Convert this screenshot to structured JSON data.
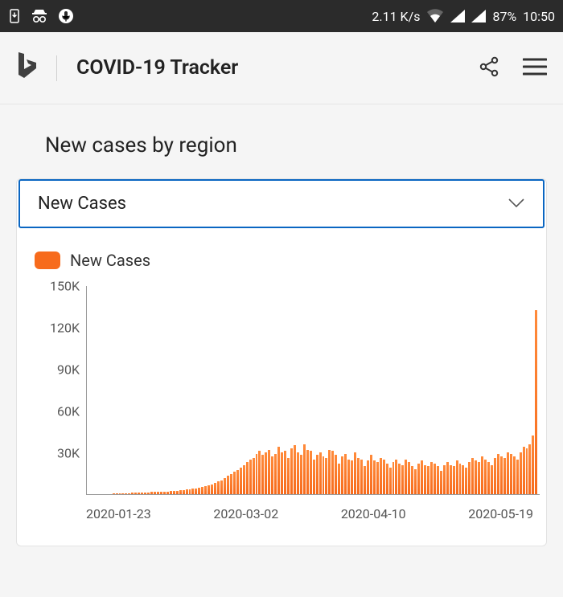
{
  "status_bar": {
    "net_speed": "2.11 K/s",
    "battery": "87%",
    "time": "10:50"
  },
  "header": {
    "title": "COVID-19 Tracker"
  },
  "section": {
    "title": "New cases by region"
  },
  "dropdown": {
    "selected": "New Cases"
  },
  "legend": {
    "label": "New Cases",
    "color": "#f76b1c"
  },
  "chart_data": {
    "type": "bar",
    "title": "New cases by region",
    "ylabel": "",
    "xlabel": "",
    "ylim": [
      0,
      150000
    ],
    "y_ticks": [
      "150K",
      "120K",
      "90K",
      "60K",
      "30K"
    ],
    "x_ticks": [
      "2020-01-23",
      "2020-03-02",
      "2020-04-10",
      "2020-05-19"
    ],
    "series": [
      {
        "name": "New Cases",
        "color": "#f76b1c",
        "values": [
          0,
          0,
          0,
          0,
          0,
          100,
          150,
          200,
          300,
          400,
          500,
          600,
          700,
          800,
          900,
          1000,
          1100,
          1200,
          1300,
          1400,
          1500,
          1600,
          1700,
          1800,
          1900,
          2000,
          2200,
          2400,
          2600,
          2800,
          3000,
          3200,
          3400,
          3800,
          4200,
          4800,
          5200,
          5900,
          6500,
          7200,
          8000,
          9000,
          10000,
          11500,
          13000,
          14500,
          16000,
          17500,
          19000,
          21000,
          23000,
          25000,
          26000,
          29000,
          31000,
          28000,
          30000,
          32000,
          27000,
          29000,
          34000,
          30000,
          31000,
          26000,
          33000,
          35000,
          30000,
          28000,
          36000,
          32000,
          31000,
          25000,
          28000,
          30000,
          27000,
          26000,
          32000,
          31000,
          28000,
          22000,
          27000,
          29000,
          25000,
          24000,
          30000,
          26000,
          25000,
          20000,
          24000,
          28000,
          24000,
          23000,
          26000,
          25000,
          22000,
          19000,
          23000,
          25000,
          22000,
          21000,
          25000,
          23000,
          20000,
          18000,
          22000,
          24000,
          21000,
          20000,
          23000,
          22000,
          20000,
          17000,
          21000,
          23000,
          21000,
          20000,
          24000,
          22000,
          21000,
          19000,
          23000,
          26000,
          24000,
          23000,
          27000,
          25000,
          23000,
          21000,
          26000,
          29000,
          27000,
          26000,
          30000,
          29000,
          27000,
          25000,
          30000,
          34000,
          33000,
          36000,
          42000,
          132000
        ]
      }
    ]
  }
}
